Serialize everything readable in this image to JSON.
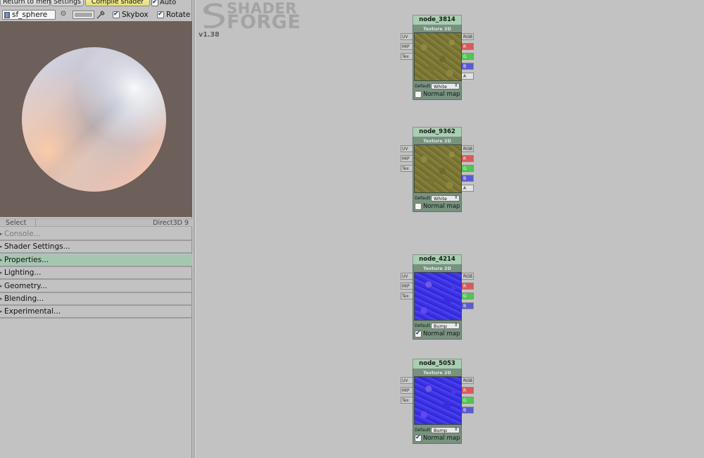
{
  "toolbar": {
    "return_label": "Return to menu",
    "settings_label": "Settings",
    "compile_label": "Compile shader",
    "auto_label": "Auto",
    "auto_checked": true
  },
  "preview_controls": {
    "mesh_value": "sf_sphere",
    "skybox_label": "Skybox",
    "skybox_checked": true,
    "rotate_label": "Rotate",
    "rotate_checked": true
  },
  "status": {
    "select_label": "Select",
    "api_label": "Direct3D 9"
  },
  "sections": [
    {
      "label": "Console...",
      "state": "dim"
    },
    {
      "label": "Shader Settings...",
      "state": "normal"
    },
    {
      "label": "Properties...",
      "state": "active"
    },
    {
      "label": "Lighting...",
      "state": "normal"
    },
    {
      "label": "Geometry...",
      "state": "normal"
    },
    {
      "label": "Blending...",
      "state": "normal"
    },
    {
      "label": "Experimental...",
      "state": "normal"
    }
  ],
  "logo": {
    "line1": "SHADER",
    "line2": "FORGE",
    "version": "v1.38"
  },
  "node_common": {
    "subtitle": "Texture 2D",
    "inputs": [
      "UV",
      "MIP",
      "Tex"
    ],
    "outputs_rgba": [
      "RGB",
      "R",
      "G",
      "B",
      "A"
    ],
    "outputs_rgb": [
      "RGB",
      "R",
      "G",
      "B"
    ],
    "default_label": "Default",
    "normal_map_label": "Normal map"
  },
  "nodes": [
    {
      "title": "node_3814",
      "default_value": "White",
      "normal_map": false,
      "texture": "ground"
    },
    {
      "title": "node_9362",
      "default_value": "White",
      "normal_map": false,
      "texture": "ground"
    },
    {
      "title": "node_4214",
      "default_value": "Bump",
      "normal_map": true,
      "texture": "bump"
    },
    {
      "title": "node_5053",
      "default_value": "Bump",
      "normal_map": true,
      "texture": "bump"
    }
  ],
  "colors": {
    "panel_bg": "#c2c2c2",
    "preview_bg": "#6d5f59",
    "node_header": "#a9cfb3",
    "section_active": "#a5c7b1",
    "compile_button": "#e3dc74"
  }
}
